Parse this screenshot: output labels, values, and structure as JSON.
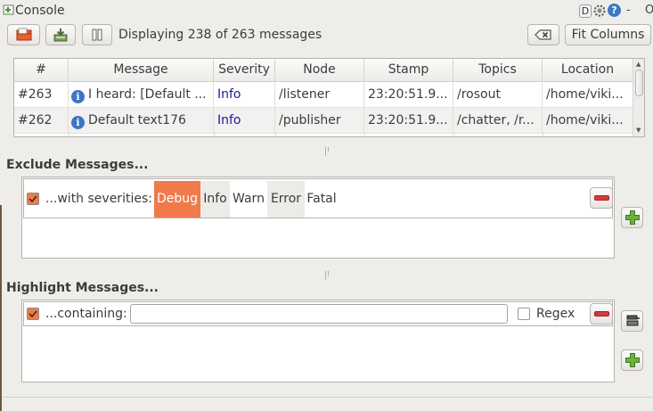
{
  "window": {
    "title": "Console",
    "help_glyph": "?",
    "d_glyph": "D",
    "minimize_glyph": "-",
    "close_glyph": "O"
  },
  "toolbar": {
    "status": "Displaying 238 of 263 messages",
    "fit_columns_label": "Fit Columns"
  },
  "table": {
    "columns": [
      "#",
      "Message",
      "Severity",
      "Node",
      "Stamp",
      "Topics",
      "Location"
    ],
    "rows": [
      {
        "num": "#263",
        "message": "I heard: [Default ...",
        "severity": "Info",
        "node": "/listener",
        "stamp": "23:20:51.9...",
        "topics": "/rosout",
        "location": "/home/viki..."
      },
      {
        "num": "#262",
        "message": "Default text176",
        "severity": "Info",
        "node": "/publisher",
        "stamp": "23:20:51.9...",
        "topics": "/chatter, /r...",
        "location": "/home/viki..."
      }
    ]
  },
  "exclude": {
    "title": "Exclude Messages...",
    "label": "...with severities:",
    "severities": [
      "Debug",
      "Info",
      "Warn",
      "Error",
      "Fatal"
    ],
    "selected": "Debug"
  },
  "highlight": {
    "title": "Highlight Messages...",
    "label": "...containing:",
    "input_value": "",
    "regex_label": "Regex"
  },
  "colors": {
    "accent": "#f07a4a",
    "severity_info": "#1c1c9a",
    "info_icon": "#3f74c2",
    "remove_red": "#d43a3a",
    "add_green": "#5aa33a"
  }
}
